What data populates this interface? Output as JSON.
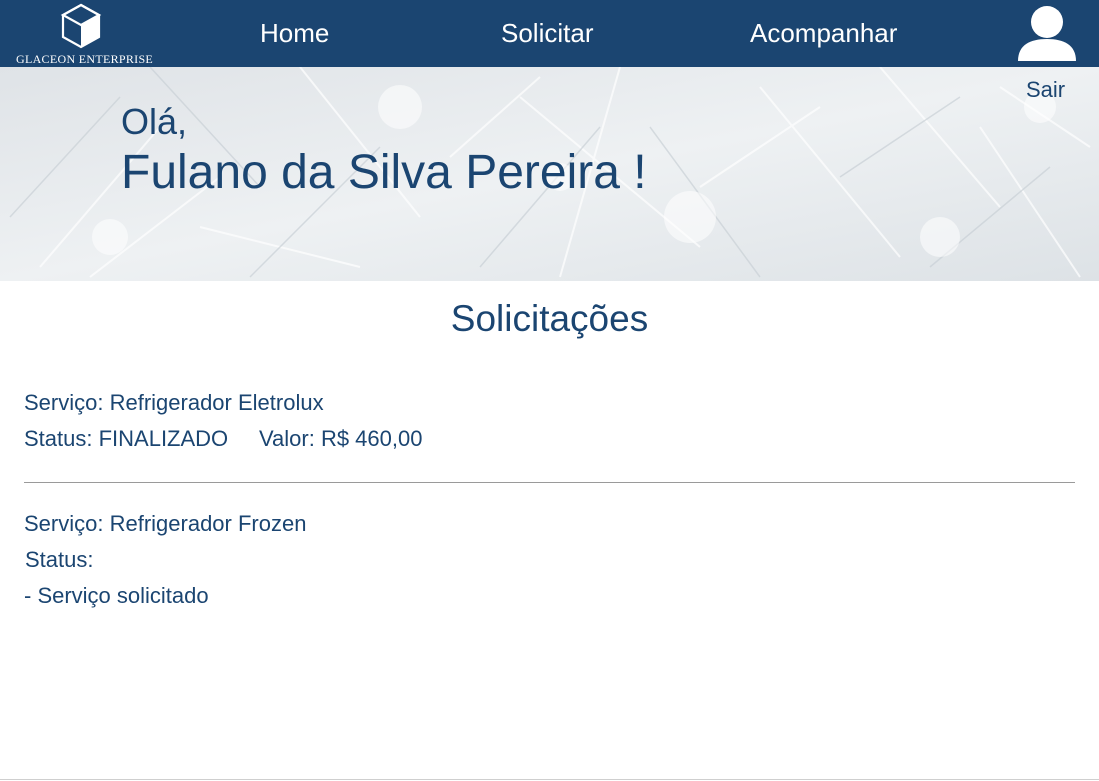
{
  "header": {
    "logo_text": "GLACEON ENTERPRISE",
    "nav": {
      "home": "Home",
      "solicitar": "Solicitar",
      "acompanhar": "Acompanhar"
    },
    "logout_label": "Sair"
  },
  "hero": {
    "greeting": "Olá,",
    "user_name": "Fulano da Silva Pereira !"
  },
  "requests": {
    "title": "Solicitações",
    "items": [
      {
        "service": "Serviço: Refrigerador Eletrolux",
        "status": "Status: FINALIZADO",
        "value": "Valor: R$ 460,00"
      },
      {
        "service": "Serviço: Refrigerador Frozen",
        "status": "Status:",
        "status_detail": "- Serviço solicitado"
      }
    ]
  },
  "colors": {
    "primary": "#1b4571",
    "background": "#ffffff",
    "hero_bg": "#e4e8ec"
  },
  "icons": {
    "logo": "cube-logo-icon",
    "user": "user-avatar-icon"
  }
}
